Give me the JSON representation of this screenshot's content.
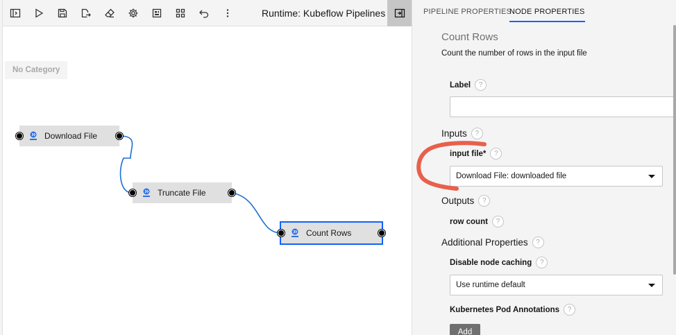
{
  "toolbar": {
    "runtime_label": "Runtime: Kubeflow Pipelines",
    "icons": [
      "open-panel-icon",
      "run-icon",
      "save-icon",
      "export-icon",
      "clear-icon",
      "settings-icon",
      "arrange-icon",
      "layout-icon",
      "undo-icon",
      "more-icon"
    ]
  },
  "canvas": {
    "category_label": "No Category",
    "nodes": [
      {
        "label": "Download File",
        "selected": false
      },
      {
        "label": "Truncate File",
        "selected": false
      },
      {
        "label": "Count Rows",
        "selected": true
      }
    ],
    "link_color": "#1c6fd1"
  },
  "properties": {
    "tabs": [
      "PIPELINE PROPERTIES",
      "NODE PROPERTIES"
    ],
    "active_tab": "NODE PROPERTIES",
    "node_title": "Count Rows",
    "node_description": "Count the number of rows in the input file",
    "label_field": {
      "label": "Label",
      "value": ""
    },
    "inputs_section": "Inputs",
    "input_file": {
      "label": "input file*",
      "value": "Download File: downloaded file"
    },
    "outputs_section": "Outputs",
    "row_count_label": "row count",
    "additional_section": "Additional Properties",
    "disable_caching": {
      "label": "Disable node caching",
      "value": "Use runtime default"
    },
    "k8s_annotations_label": "Kubernetes Pod Annotations",
    "add_button": "Add",
    "help_glyph": "?"
  },
  "colors": {
    "accent": "#0f62fe",
    "annotation": "#e8604c"
  }
}
